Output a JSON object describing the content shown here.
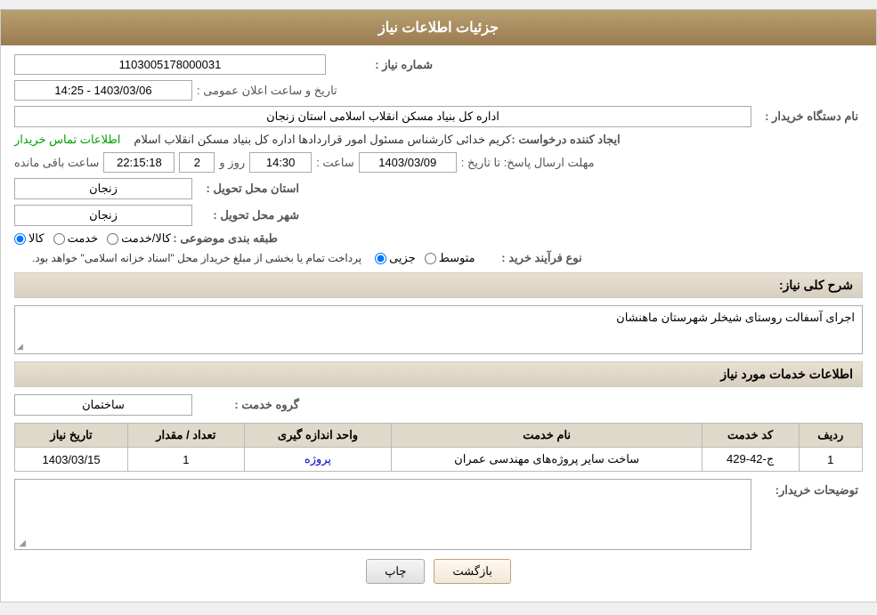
{
  "header": {
    "title": "جزئیات اطلاعات نیاز"
  },
  "fields": {
    "need_number_label": "شماره نیاز :",
    "need_number_value": "1103005178000031",
    "date_time_label": "تاریخ و ساعت اعلان عمومی :",
    "date_time_value": "1403/03/06 - 14:25",
    "buyer_org_label": "نام دستگاه خریدار :",
    "buyer_org_value": "اداره کل بنیاد مسکن انقلاب اسلامی استان زنجان",
    "creator_label": "ایجاد کننده درخواست :",
    "creator_value": "کریم خدائی کارشناس مسئول امور قراردادها اداره کل بنیاد مسکن انقلاب اسلام",
    "contact_link": "اطلاعات تماس خریدار",
    "deadline_label": "مهلت ارسال پاسخ: تا تاریخ :",
    "deadline_date": "1403/03/09",
    "deadline_time_label": "ساعت :",
    "deadline_time": "14:30",
    "deadline_days_label": "روز و",
    "deadline_days": "2",
    "deadline_remaining_label": "ساعت باقی مانده",
    "deadline_remaining": "22:15:18",
    "province_label": "استان محل تحویل :",
    "province_value": "زنجان",
    "city_label": "شهر محل تحویل :",
    "city_value": "زنجان",
    "category_label": "طبقه بندی موضوعی :",
    "category_options": [
      "کالا",
      "خدمت",
      "کالا/خدمت"
    ],
    "category_selected": "کالا",
    "purchase_type_label": "نوع فرآیند خرید :",
    "purchase_type_options": [
      "جزیی",
      "متوسط"
    ],
    "purchase_type_selected": "جزیی",
    "purchase_note": "پرداخت تمام یا بخشی از مبلغ خریداز محل \"اسناد خزانه اسلامی\" خواهد بود.",
    "description_label": "شرح کلی نیاز:",
    "description_value": "اجرای آسفالت روستای شیخلر شهرستان ماهنشان",
    "services_header": "اطلاعات خدمات مورد نیاز",
    "service_group_label": "گروه خدمت :",
    "service_group_value": "ساختمان",
    "table": {
      "columns": [
        "ردیف",
        "کد خدمت",
        "نام خدمت",
        "واحد اندازه گیری",
        "تعداد / مقدار",
        "تاریخ نیاز"
      ],
      "rows": [
        {
          "row": "1",
          "code": "ج-42-429",
          "name": "ساخت سایر پروژه‌های مهندسی عمران",
          "unit": "پروژه",
          "qty": "1",
          "date": "1403/03/15"
        }
      ]
    },
    "buyer_notes_label": "توضیحات خریدار:",
    "buyer_notes_value": ""
  },
  "buttons": {
    "print_label": "چاپ",
    "back_label": "بازگشت"
  }
}
